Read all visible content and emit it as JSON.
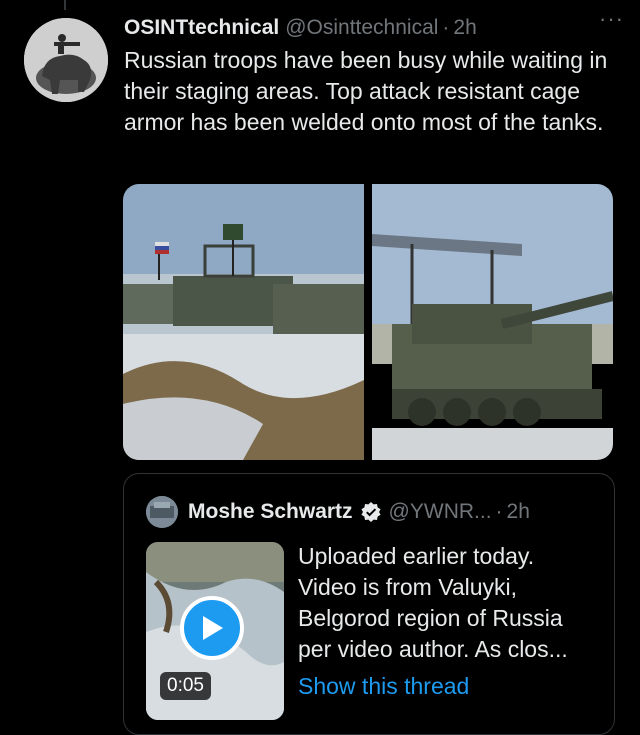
{
  "tweet": {
    "display_name": "OSINTtechnical",
    "handle": "@Osinttechnical",
    "separator": "·",
    "time": "2h",
    "more_label": "···",
    "text": "Russian troops have been busy while waiting in their staging areas. Top attack resistant cage armor has been welded onto most of the tanks."
  },
  "quoted": {
    "display_name": "Moshe Schwartz",
    "handle": "@YWNR...",
    "separator": "·",
    "time": "2h",
    "text": "Uploaded earlier today. Video is from Valuyki, Belgorod region of Russia per video author. As clos...",
    "show_thread": "Show this thread",
    "video_duration": "0:05"
  },
  "colors": {
    "background": "#000000",
    "text": "#e7e9ea",
    "muted": "#71767b",
    "accent": "#1d9bf0",
    "border": "#2f3336"
  },
  "icons": {
    "more": "more-dots-icon",
    "verified": "verified-badge-icon",
    "play": "play-icon"
  }
}
